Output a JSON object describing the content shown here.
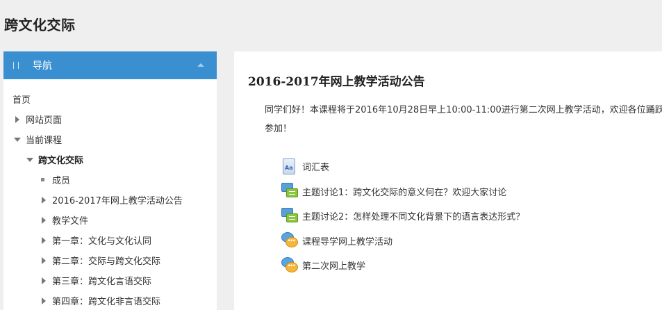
{
  "page": {
    "title": "跨文化交际"
  },
  "navigation": {
    "header_label": "导航",
    "items": [
      {
        "label": "首页"
      },
      {
        "label": "网站页面"
      },
      {
        "label": "当前课程"
      },
      {
        "label": "跨文化交际"
      },
      {
        "label": "成员"
      },
      {
        "label": "2016-2017年网上教学活动公告"
      },
      {
        "label": "教学文件"
      },
      {
        "label": "第一章：文化与文化认同"
      },
      {
        "label": "第二章：交际与跨文化交际"
      },
      {
        "label": "第三章：跨文化言语交际"
      },
      {
        "label": "第四章：跨文化非言语交际"
      }
    ]
  },
  "main": {
    "heading": "2016-2017年网上教学活动公告",
    "intro": "同学们好！本课程将于2016年10月28日早上10:00-11:00进行第二次网上教学活动，欢迎各位踊跃参加！",
    "activities": [
      {
        "icon": "glossary-icon",
        "label": "词汇表"
      },
      {
        "icon": "forum-icon",
        "label": "主题讨论1：跨文化交际的意义何在？欢迎大家讨论"
      },
      {
        "icon": "forum-icon",
        "label": "主题讨论2：怎样处理不同文化背景下的语言表达形式？"
      },
      {
        "icon": "chat-icon",
        "label": "课程导学网上教学活动"
      },
      {
        "icon": "chat-icon",
        "label": "第二次网上教学"
      }
    ]
  },
  "colors": {
    "nav_header": "#3a8fd0",
    "page_background": "#efefef"
  }
}
